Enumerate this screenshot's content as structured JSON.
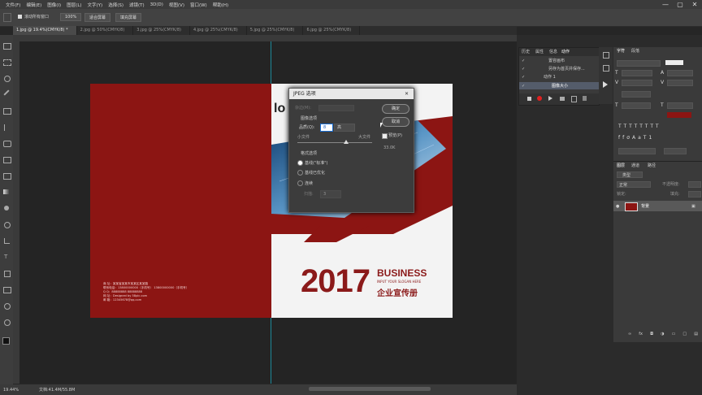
{
  "menu": [
    "文件(F)",
    "编辑(E)",
    "图像(I)",
    "图层(L)",
    "文字(Y)",
    "选择(S)",
    "滤镜(T)",
    "3D(D)",
    "视图(V)",
    "窗口(W)",
    "帮助(H)"
  ],
  "window_controls": [
    "—",
    "▢",
    "✕"
  ],
  "options": {
    "scroll_all_label": "滚动所有窗口",
    "zoom_value": "100%",
    "fit_screen_label": "适合屏幕",
    "fill_screen_label": "填充屏幕"
  },
  "tabs": [
    "1.jpg @ 19.4%(CMYK/8) *",
    "2.jpg @ 50%(CMYK/8)",
    "3.jpg @ 25%(CMYK/8)",
    "4.jpg @ 25%(CMYK/8)",
    "5.jpg @ 25%(CMYK/8)",
    "6.jpg @ 25%(CMYK/8)"
  ],
  "cover": {
    "logo_text": "lo",
    "year": "2017",
    "business": "BUSINESS",
    "slogan": "INPUT YOUR SLOGAN HERE",
    "subtitle": "企业宣传册",
    "contact_lines": [
      "商 址：某某省某某市某某区某某路",
      "联系电话：13800000000（手机号） 13800000000（手机号）",
      "Q Q：88888888 88888888",
      "网 址：Designed by 58pic.com",
      "邮 箱：12345678@qq.com"
    ]
  },
  "dialog": {
    "title": "JPEG 选项",
    "close": "✕",
    "matte_label": "杂边(M):",
    "image_options": "图像选项",
    "quality_label": "品质(Q):",
    "quality_value": "8",
    "quality_level": "高",
    "small_file": "小文件",
    "large_file": "大文件",
    "format_options": "格式选项",
    "baseline_standard": "基线(\"标准\")",
    "baseline_optimized": "基线已优化",
    "progressive": "连续",
    "scans_label": "扫描:",
    "scans_value": "3",
    "ok": "确定",
    "cancel": "取消",
    "preview": "预览(P)",
    "size": "33.0K"
  },
  "actions_panel": {
    "tabs": [
      "历史",
      "属性",
      "信息",
      "动作"
    ],
    "items": [
      "置容画布",
      "另存为首页并保存...",
      "动作 1",
      "图像大小"
    ]
  },
  "char_panel": {
    "tabs": [
      "字符",
      "段落"
    ]
  },
  "layers_panel": {
    "tabs": [
      "图层",
      "通道",
      "路径"
    ],
    "kind_label": "类型",
    "mode": "正常",
    "opacity_label": "不透明度:",
    "fill_label": "填充:",
    "lock_label": "锁定:",
    "layer_name": "背景"
  },
  "status": {
    "zoom": "19.44%",
    "doc": "文档:41.4M/55.8M"
  },
  "colors": {
    "brand_red": "#8c1513",
    "cover_text_red": "#8b1a1a"
  }
}
